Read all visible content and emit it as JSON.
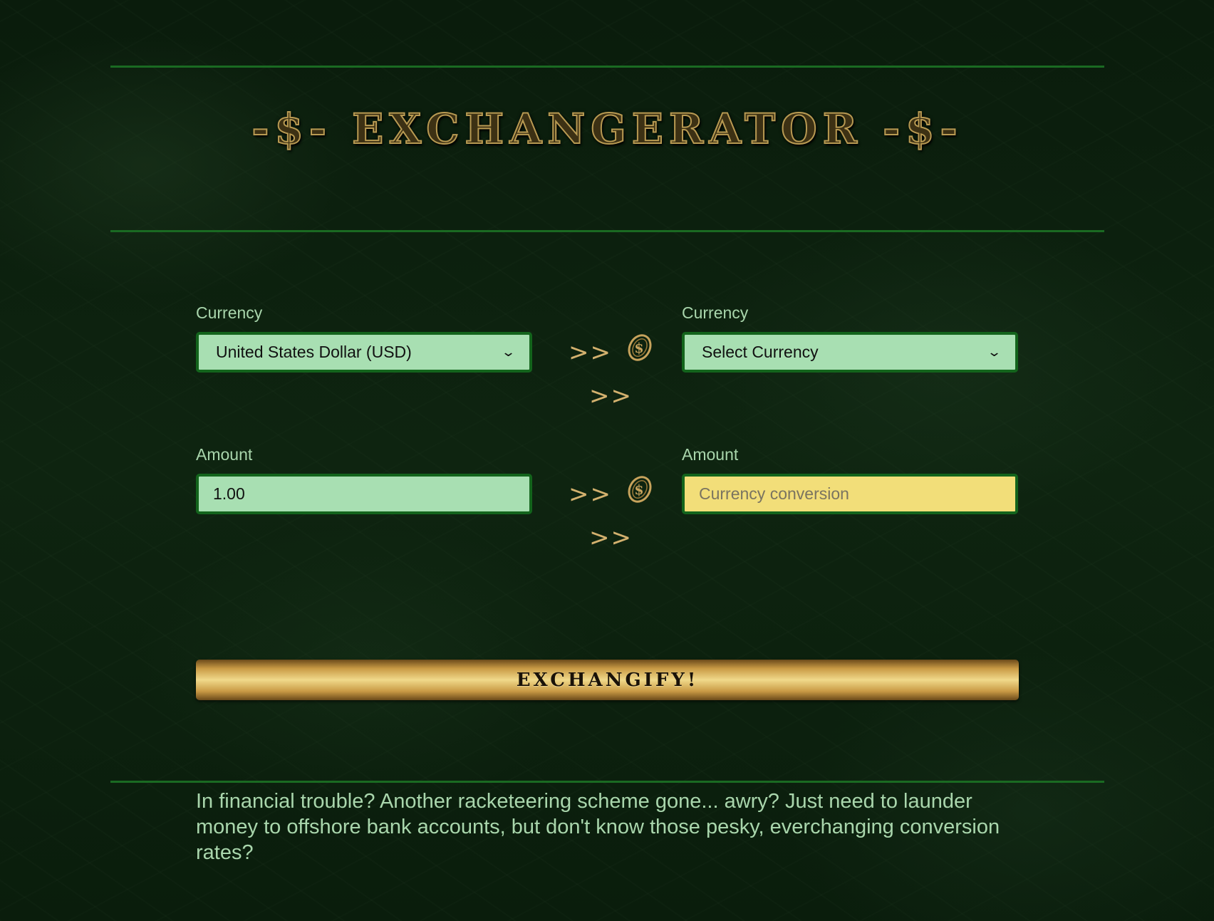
{
  "header": {
    "title": "-$- EXCHANGERATOR -$-"
  },
  "converter": {
    "from": {
      "currency_label": "Currency",
      "currency_value": "United States Dollar (USD)",
      "amount_label": "Amount",
      "amount_value": "1.00"
    },
    "to": {
      "currency_label": "Currency",
      "currency_value": "Select Currency",
      "amount_label": "Amount",
      "amount_placeholder": "Currency conversion"
    },
    "arrow_text": ">>",
    "arrow_icon": "dollar-coin-icon",
    "submit_label": "EXCHANGIFY!"
  },
  "intro_text": "In financial trouble? Another racketeering scheme gone... awry? Just need to launder money to offshore bank accounts, but don't know those pesky, everchanging conversion rates?",
  "colors": {
    "background": "#0b1f0d",
    "rule": "#1a6a22",
    "field_fill": "#a8dfb2",
    "field_border": "#13641c",
    "output_fill": "#f2de79",
    "gold": "#d3b16e",
    "label_text": "#a9d6ac"
  }
}
